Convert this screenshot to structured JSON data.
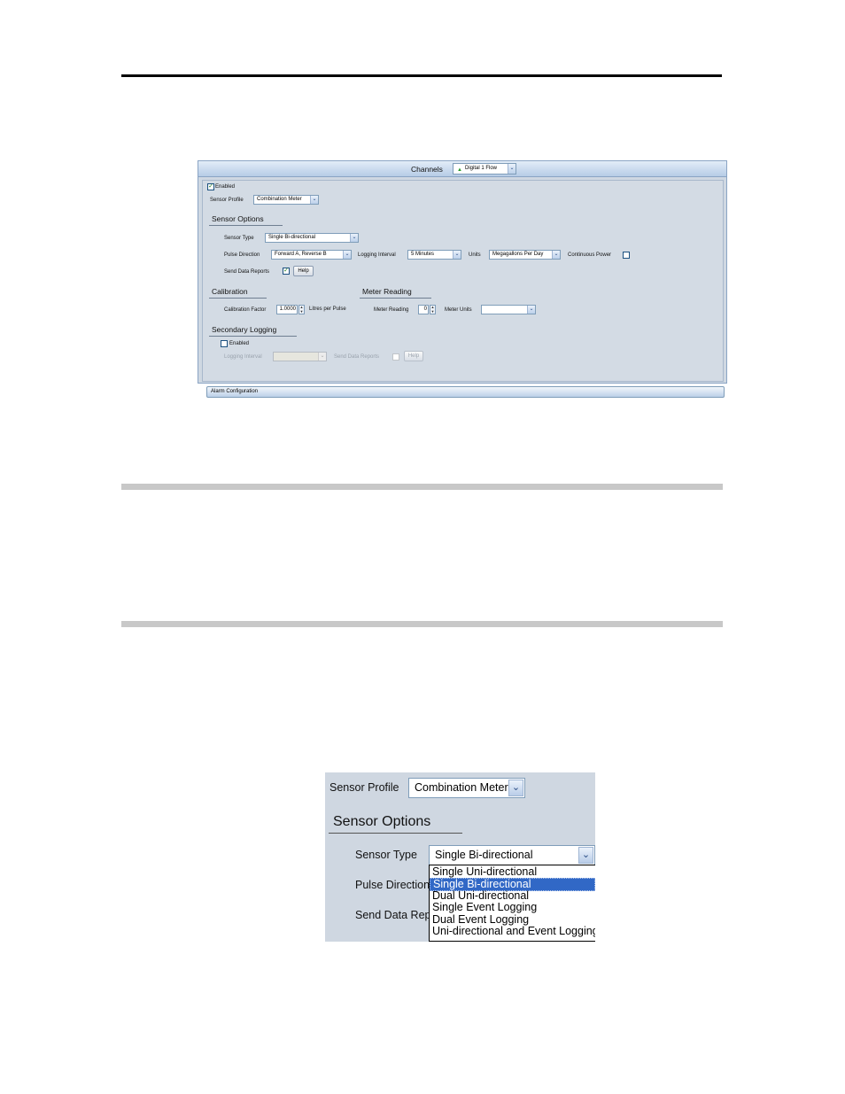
{
  "screen1": {
    "channels_label": "Channels",
    "channel_select": "Digital 1 Flow",
    "enabled_label": "Enabled",
    "sensor_profile_label": "Sensor Profile",
    "sensor_profile_value": "Combination Meter",
    "sensor_options_title": "Sensor Options",
    "sensor_type_label": "Sensor Type",
    "sensor_type_value": "Single Bi-directional",
    "pulse_direction_label": "Pulse Direction",
    "pulse_direction_value": "Forward A, Reverse B",
    "logging_interval_label": "Logging Interval",
    "logging_interval_value": "5 Minutes",
    "units_label": "Units",
    "units_value": "Megagallons Per Day",
    "continuous_power_label": "Continuous Power",
    "send_data_reports_label": "Send Data Reports",
    "help_label": "Help",
    "calibration_title": "Calibration",
    "calibration_factor_label": "Calibration Factor",
    "calibration_factor_value": "1.0000",
    "calibration_units": "Litres per Pulse",
    "meter_reading_title": "Meter Reading",
    "meter_reading_label": "Meter Reading",
    "meter_reading_value": "0",
    "meter_units_label": "Meter Units",
    "meter_units_value": "",
    "secondary_logging_title": "Secondary Logging",
    "secondary_enabled_label": "Enabled",
    "secondary_logging_interval_label": "Logging Interval",
    "secondary_send_data_reports_label": "Send Data Reports",
    "secondary_help_label": "Help",
    "alarm_configuration_label": "Alarm Configuration"
  },
  "screen2": {
    "sensor_profile_label": "Sensor Profile",
    "sensor_profile_value": "Combination Meter",
    "sensor_options_title": "Sensor Options",
    "sensor_type_label": "Sensor Type",
    "sensor_type_value": "Single Bi-directional",
    "pulse_direction_label": "Pulse Direction",
    "send_data_label": "Send Data Rep",
    "dropdown_options": [
      "Single Uni-directional",
      "Single Bi-directional",
      "Dual Uni-directional",
      "Single Event Logging",
      "Dual Event Logging",
      "Uni-directional and Event Logging"
    ],
    "selected_option": "Single Bi-directional"
  },
  "colors": {
    "panel_bg": "#d3dbe4",
    "header_gradient_top": "#e3edf8",
    "header_gradient_bottom": "#b6cce6",
    "selection": "#3168c6",
    "rule_gray": "#c8c8c8"
  },
  "icons": [
    "chevron-down-icon",
    "checkmark-icon",
    "spin-up-icon",
    "spin-down-icon",
    "green-triangle-icon"
  ]
}
